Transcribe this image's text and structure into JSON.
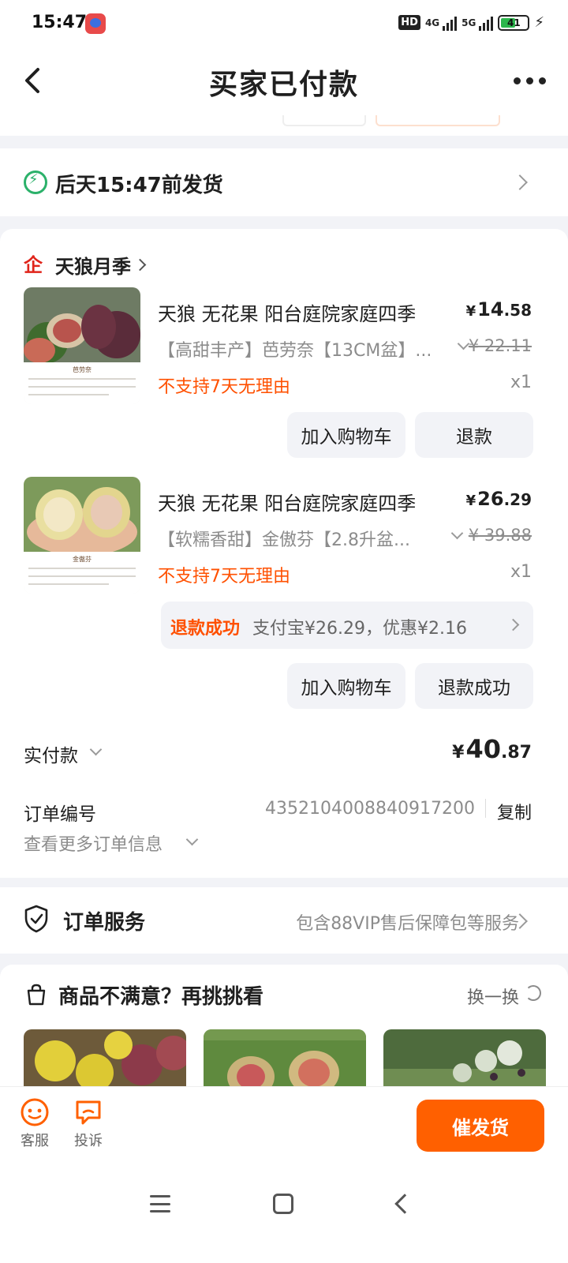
{
  "status_bar": {
    "time": "15:47",
    "hd_label": "HD",
    "net_1": "4G",
    "net_2": "5G",
    "battery": "41"
  },
  "nav": {
    "title": "买家已付款"
  },
  "shipping": {
    "text": "后天15:47前发货"
  },
  "shop": {
    "logo_glyph": "企",
    "name": "天狼月季"
  },
  "items": [
    {
      "title": "天狼 无花果 阳台庭院家庭四季",
      "price_int": "14",
      "price_dec": ".58",
      "spec": "【高甜丰产】芭劳奈【13CM盆】...",
      "orig_price": "¥ 22.11",
      "tag": "不支持7天无理由",
      "qty": "x1",
      "caption": "芭劳奈",
      "btn_cart": "加入购物车",
      "btn_refund": "退款"
    },
    {
      "title": "天狼 无花果 阳台庭院家庭四季",
      "price_int": "26",
      "price_dec": ".29",
      "spec": "【软糯香甜】金傲芬【2.8升盆...",
      "orig_price": "¥ 39.88",
      "tag": "不支持7天无理由",
      "qty": "x1",
      "caption": "金傲芬",
      "refund_status": "退款成功",
      "refund_info": "支付宝¥26.29，优惠¥2.16",
      "btn_cart": "加入购物车",
      "btn_refund": "退款成功"
    }
  ],
  "currency_symbol": "¥",
  "paid": {
    "label": "实付款",
    "amount_int": "40",
    "amount_dec": ".87"
  },
  "order": {
    "number_label": "订单编号",
    "number": "4352104008840917200",
    "copy_label": "复制",
    "more_label": "查看更多订单信息"
  },
  "service": {
    "label": "订单服务",
    "desc": "包含88VIP售后保障包等服务"
  },
  "reco": {
    "title": "商品不满意？再挑挑看",
    "switch_label": "换一换"
  },
  "bottom": {
    "service_label": "客服",
    "complaint_label": "投诉",
    "urge_label": "催发货"
  },
  "colors": {
    "accent": "#ff5000",
    "button_primary": "#ff6000",
    "ship_green": "#2bb16a",
    "shop_red": "#e0251b"
  },
  "icons": {
    "back": "back-arrow-icon",
    "more": "more-dots-icon",
    "ship": "lightning-icon",
    "shop": "shop-logo-icon",
    "service": "shield-check-icon",
    "reco": "shopping-bag-icon",
    "refresh": "refresh-icon",
    "customer_service": "smile-face-icon",
    "complaint": "chat-bubble-icon"
  }
}
